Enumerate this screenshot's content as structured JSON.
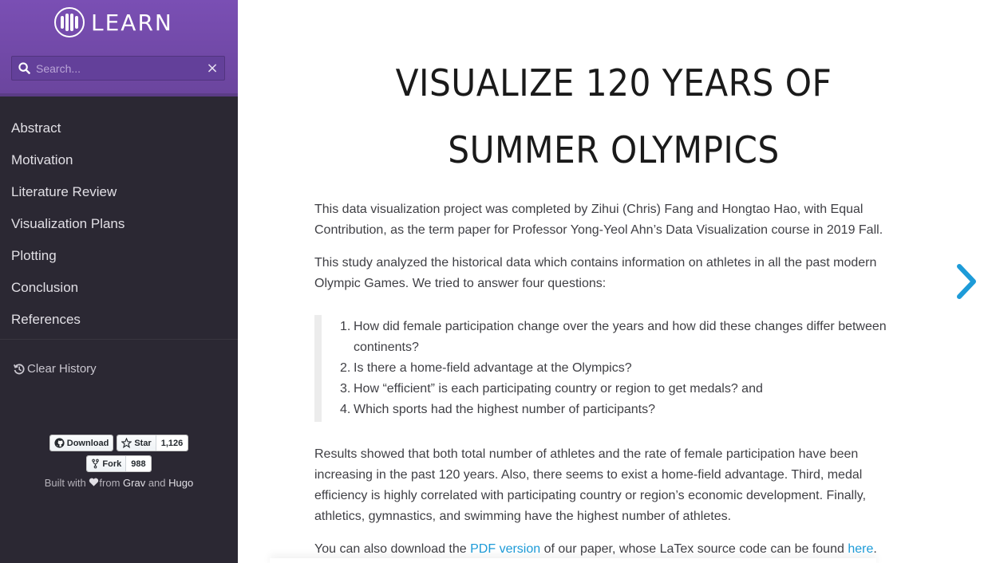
{
  "sidebar": {
    "logo_text": "LEARN",
    "search": {
      "placeholder": "Search..."
    },
    "clear_search": "×",
    "items": [
      {
        "label": "Abstract"
      },
      {
        "label": "Motivation"
      },
      {
        "label": "Literature Review"
      },
      {
        "label": "Visualization Plans"
      },
      {
        "label": "Plotting"
      },
      {
        "label": "Conclusion"
      },
      {
        "label": "References"
      }
    ],
    "clear_history": "Clear History",
    "badges": {
      "download": "Download",
      "star": "Star",
      "star_count": "1,126",
      "fork": "Fork",
      "fork_count": "988"
    },
    "built_with": {
      "prefix": "Built with",
      "from": "from",
      "grav": "Grav",
      "and": "and",
      "hugo": "Hugo"
    }
  },
  "main": {
    "title_line1": "VISUALIZE 120 YEARS OF",
    "title_line2": "SUMMER OLYMPICS",
    "p1": "This data visualization project was completed by Zihui (Chris) Fang and Hongtao Hao, with Equal Contribution, as the term paper for Professor Yong-Yeol Ahn’s Data Visualization course in 2019 Fall.",
    "p2": "This study analyzed the historical data which contains information on athletes in all the past modern Olympic Games. We tried to answer four questions:",
    "questions": [
      {
        "num": "1.",
        "text": "How did female participation change over the years and how did these changes differ between continents?"
      },
      {
        "num": "2.",
        "text": "Is there a home-field advantage at the Olympics?"
      },
      {
        "num": "3.",
        "text": "How “efficient” is each participating country or region to get medals? and"
      },
      {
        "num": "4.",
        "text": "Which sports had the highest number of participants?"
      }
    ],
    "p3": "Results showed that both total number of athletes and the rate of female participation have been increasing in the past 120 years. Also, there seems to exist a home-field advantage. Third, medal efficiency is highly correlated with participating country or region’s economic development. Finally, athletics, gymnastics, and swimming have the highest number of athletes.",
    "p4": {
      "before": "You can also download the ",
      "pdf_link": "PDF version",
      "middle": " of our paper, whose LaTex source code can be found ",
      "here_link": "here",
      "after": "."
    }
  },
  "colors": {
    "sidebar_header": "#6b459e",
    "sidebar_bg": "#2b2833",
    "link": "#1d9bd8",
    "arrow": "#1d9bd8"
  }
}
